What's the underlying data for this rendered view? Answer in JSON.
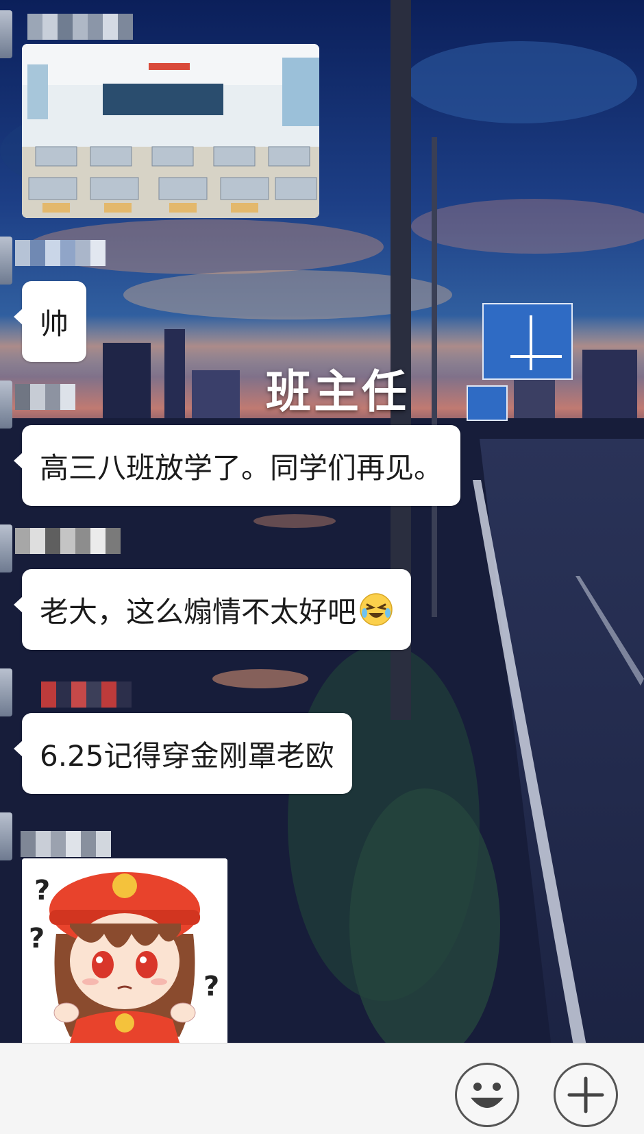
{
  "overlay": {
    "caption": "班主任"
  },
  "messages": [
    {
      "type": "image",
      "depicts": "classroom photo"
    },
    {
      "type": "text",
      "text": "帅"
    },
    {
      "type": "text",
      "text": "高三八班放学了。同学们再见。"
    },
    {
      "type": "text",
      "text": "老大，这么煽情不太好吧",
      "emoji": "crying-laugh-emoji"
    },
    {
      "type": "text",
      "text": "6.25记得穿金刚罩老欧"
    },
    {
      "type": "sticker",
      "depicts": "chibi girl with red hat and question marks"
    }
  ],
  "input_bar": {
    "emoji_button_icon": "smiley-face-icon",
    "more_button_icon": "plus-icon"
  },
  "colors": {
    "bubble": "#ffffff",
    "input_bar": "#f5f5f5",
    "caption_text": "#ffffff"
  }
}
